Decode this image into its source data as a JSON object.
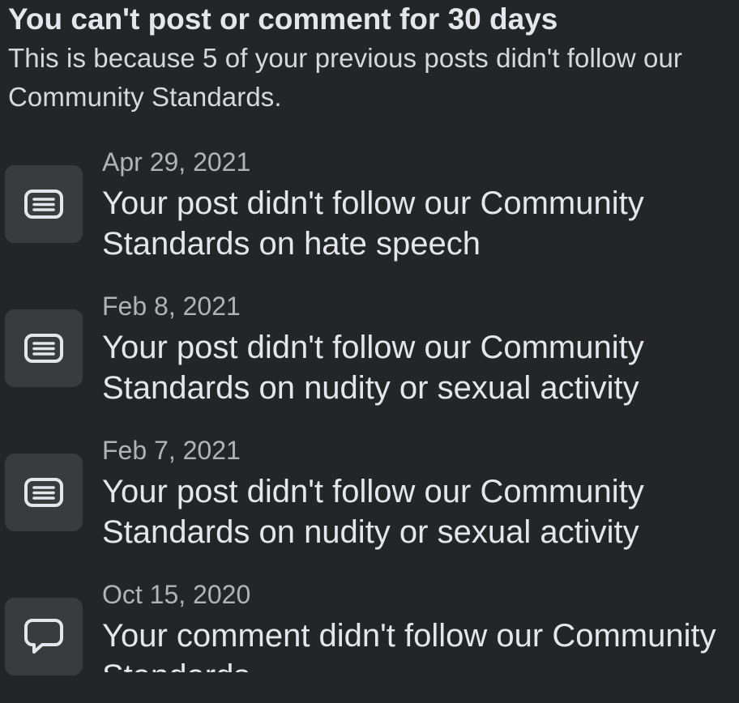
{
  "header": {
    "title": "You can't post or comment for 30 days",
    "subtitle": "This is because 5 of your previous posts didn't follow our Community Standards."
  },
  "violations": [
    {
      "date": "Apr 29, 2021",
      "message": "Your post didn't follow our Community Standards on hate speech",
      "icon": "post-icon"
    },
    {
      "date": "Feb 8, 2021",
      "message": "Your post didn't follow our Community Standards on nudity or sexual activity",
      "icon": "post-icon"
    },
    {
      "date": "Feb 7, 2021",
      "message": "Your post didn't follow our Community Standards on nudity or sexual activity",
      "icon": "post-icon"
    },
    {
      "date": "Oct 15, 2020",
      "message": "Your comment didn't follow our Community Standards",
      "icon": "comment-icon"
    }
  ],
  "colors": {
    "background": "#242526",
    "icon_box": "#3a3b3c",
    "primary_text": "#e4e6eb",
    "secondary_text": "#b0b3b8"
  }
}
